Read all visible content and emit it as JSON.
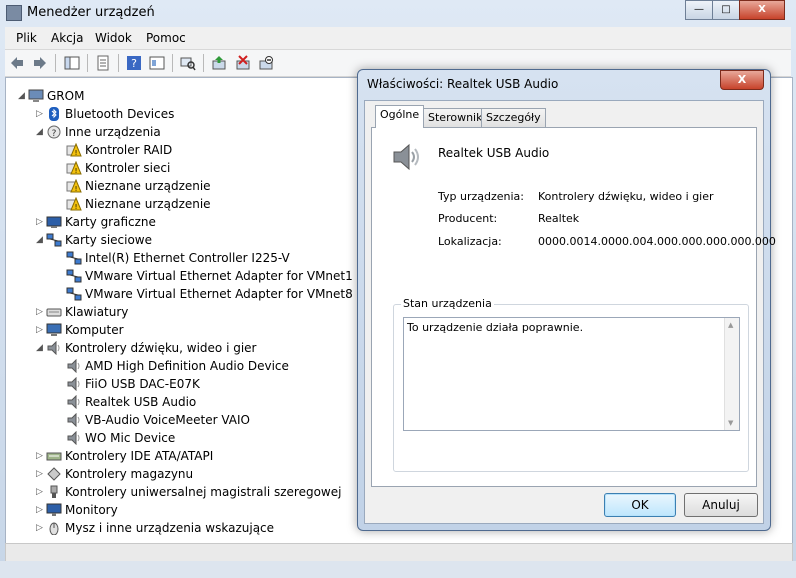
{
  "window": {
    "title": "Menedżer urządzeń",
    "minimize": "—",
    "maximize": "□",
    "close": "X"
  },
  "menu": [
    "Plik",
    "Akcja",
    "Widok",
    "Pomoc"
  ],
  "tree": {
    "root": "GROM",
    "items": [
      {
        "label": "Bluetooth Devices",
        "icon": "bluetooth-icon",
        "level": 1,
        "expanded": false
      },
      {
        "label": "Inne urządzenia",
        "icon": "unknown-device-icon",
        "level": 1,
        "expanded": true
      },
      {
        "label": "Kontroler RAID",
        "icon": "warning-device-icon",
        "level": 2
      },
      {
        "label": "Kontroler sieci",
        "icon": "warning-device-icon",
        "level": 2
      },
      {
        "label": "Nieznane urządzenie",
        "icon": "warning-device-icon",
        "level": 2
      },
      {
        "label": "Nieznane urządzenie",
        "icon": "warning-device-icon",
        "level": 2
      },
      {
        "label": "Karty graficzne",
        "icon": "display-adapter-icon",
        "level": 1,
        "expanded": false
      },
      {
        "label": "Karty sieciowe",
        "icon": "network-adapter-icon",
        "level": 1,
        "expanded": true
      },
      {
        "label": "Intel(R) Ethernet Controller I225-V",
        "icon": "network-adapter-icon",
        "level": 2
      },
      {
        "label": "VMware Virtual Ethernet Adapter for VMnet1",
        "icon": "network-adapter-icon",
        "level": 2
      },
      {
        "label": "VMware Virtual Ethernet Adapter for VMnet8",
        "icon": "network-adapter-icon",
        "level": 2
      },
      {
        "label": "Klawiatury",
        "icon": "keyboard-icon",
        "level": 1,
        "expanded": false
      },
      {
        "label": "Komputer",
        "icon": "computer-icon",
        "level": 1,
        "expanded": false
      },
      {
        "label": "Kontrolery dźwięku, wideo i gier",
        "icon": "speaker-icon",
        "level": 1,
        "expanded": true
      },
      {
        "label": "AMD High Definition Audio Device",
        "icon": "speaker-icon",
        "level": 2
      },
      {
        "label": "FiiO USB DAC-E07K",
        "icon": "speaker-icon",
        "level": 2
      },
      {
        "label": "Realtek USB Audio",
        "icon": "speaker-icon",
        "level": 2
      },
      {
        "label": "VB-Audio VoiceMeeter VAIO",
        "icon": "speaker-icon",
        "level": 2
      },
      {
        "label": "WO Mic Device",
        "icon": "speaker-icon",
        "level": 2
      },
      {
        "label": "Kontrolery IDE ATA/ATAPI",
        "icon": "ide-controller-icon",
        "level": 1,
        "expanded": false
      },
      {
        "label": "Kontrolery magazynu",
        "icon": "storage-controller-icon",
        "level": 1,
        "expanded": false
      },
      {
        "label": "Kontrolery uniwersalnej magistrali szeregowej",
        "icon": "usb-icon",
        "level": 1,
        "expanded": false
      },
      {
        "label": "Monitory",
        "icon": "monitor-icon",
        "level": 1,
        "expanded": false
      },
      {
        "label": "Mysz i inne urządzenia wskazujące",
        "icon": "mouse-icon",
        "level": 1,
        "expanded": false
      }
    ]
  },
  "dialog": {
    "title": "Właściwości: Realtek USB Audio",
    "close": "X",
    "tabs": [
      "Ogólne",
      "Sterownik",
      "Szczegóły"
    ],
    "active_tab": "Ogólne",
    "device_name": "Realtek USB Audio",
    "properties": [
      {
        "label": "Typ urządzenia:",
        "value": "Kontrolery dźwięku, wideo i gier"
      },
      {
        "label": "Producent:",
        "value": "Realtek"
      },
      {
        "label": "Lokalizacja:",
        "value": "0000.0014.0000.004.000.000.000.000.000"
      }
    ],
    "status_group_title": "Stan urządzenia",
    "status_text": "To urządzenie działa poprawnie.",
    "ok_label": "OK",
    "cancel_label": "Anuluj"
  }
}
